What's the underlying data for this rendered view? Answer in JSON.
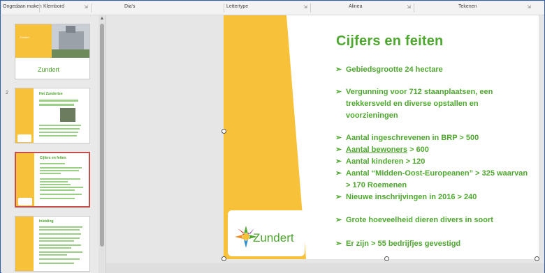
{
  "ribbon": {
    "groups": [
      "Ongedaan maken",
      "Klembord",
      "Dia's",
      "Lettertype",
      "Alinea",
      "Tekenen"
    ],
    "launcher_icon": "dialog-launcher-icon",
    "launcher_glyph": "⇲"
  },
  "thumbnails": [
    {
      "number": "1",
      "title": "Zundert",
      "kind": "title-slide"
    },
    {
      "number": "2",
      "title": "Het Zundertse",
      "kind": "content-photo"
    },
    {
      "number": "3",
      "title": "Cijfers en feiten",
      "kind": "content",
      "selected": true
    },
    {
      "number": "4",
      "title": "Inleiding",
      "kind": "content"
    }
  ],
  "slide": {
    "title": "Cijfers en feiten",
    "bullets": [
      {
        "text": "Gebiedsgrootte 24 hectare"
      },
      {
        "text": "Vergunning voor  712 staanplaatsen, een"
      },
      {
        "text": "trekkersveld en diverse  opstallen en",
        "continuation": true
      },
      {
        "text": "voorzieningen",
        "continuation": true
      },
      {
        "text": "Aantal ingeschrevenen in BRP > 500"
      },
      {
        "text_underlined": "Aantal bewoners",
        "text_rest": " > 600"
      },
      {
        "text": "Aantal kinderen > 120"
      },
      {
        "text": "Aantal “Midden-Oost-Europeanen” > 325 waarvan"
      },
      {
        "text": "> 170  Roemenen",
        "continuation": true
      },
      {
        "text": "Nieuwe inschrijvingen in 2016 > 240"
      },
      {
        "text": "Grote hoeveelheid dieren divers in soort"
      },
      {
        "text": "Er zijn > 55 bedrijfjes gevestigd"
      }
    ],
    "bullet_glyph": "➢",
    "logo_text": "Zundert",
    "colors": {
      "green": "#4ea72e",
      "yellow": "#f7c23a"
    }
  }
}
